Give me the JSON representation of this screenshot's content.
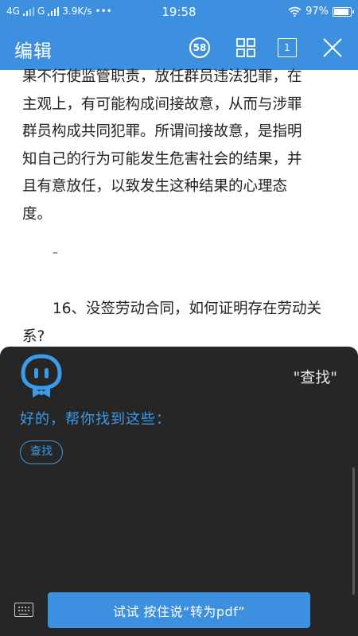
{
  "status_bar": {
    "network_1": "4G",
    "network_2": "G",
    "speed": "3.9K/s",
    "more": "•••",
    "time": "19:58",
    "battery": "97%",
    "battery_level": 0.97
  },
  "app_bar": {
    "title": "编辑",
    "badge_label": "58",
    "page_label": "1"
  },
  "document": {
    "paragraph_lines": [
      "果不行使监管职责，放任群员违法犯罪，在",
      "主观上，有可能构成间接故意，从而与涉罪",
      "群员构成共同犯罪。所谓间接故意，是指明",
      "知自己的行为可能发生危害社会的结果，并",
      "且有意放任，以致发生这种结果的心理态",
      "度。"
    ],
    "separator": "–",
    "question": "16、没签劳动合同，如何证明存在劳动关系?"
  },
  "assistant": {
    "query": "\"查找\"",
    "reply": "好的，帮你找到这些：",
    "chip_label": "查找",
    "voice_button_label": "试试 按住说“转为pdf”"
  }
}
